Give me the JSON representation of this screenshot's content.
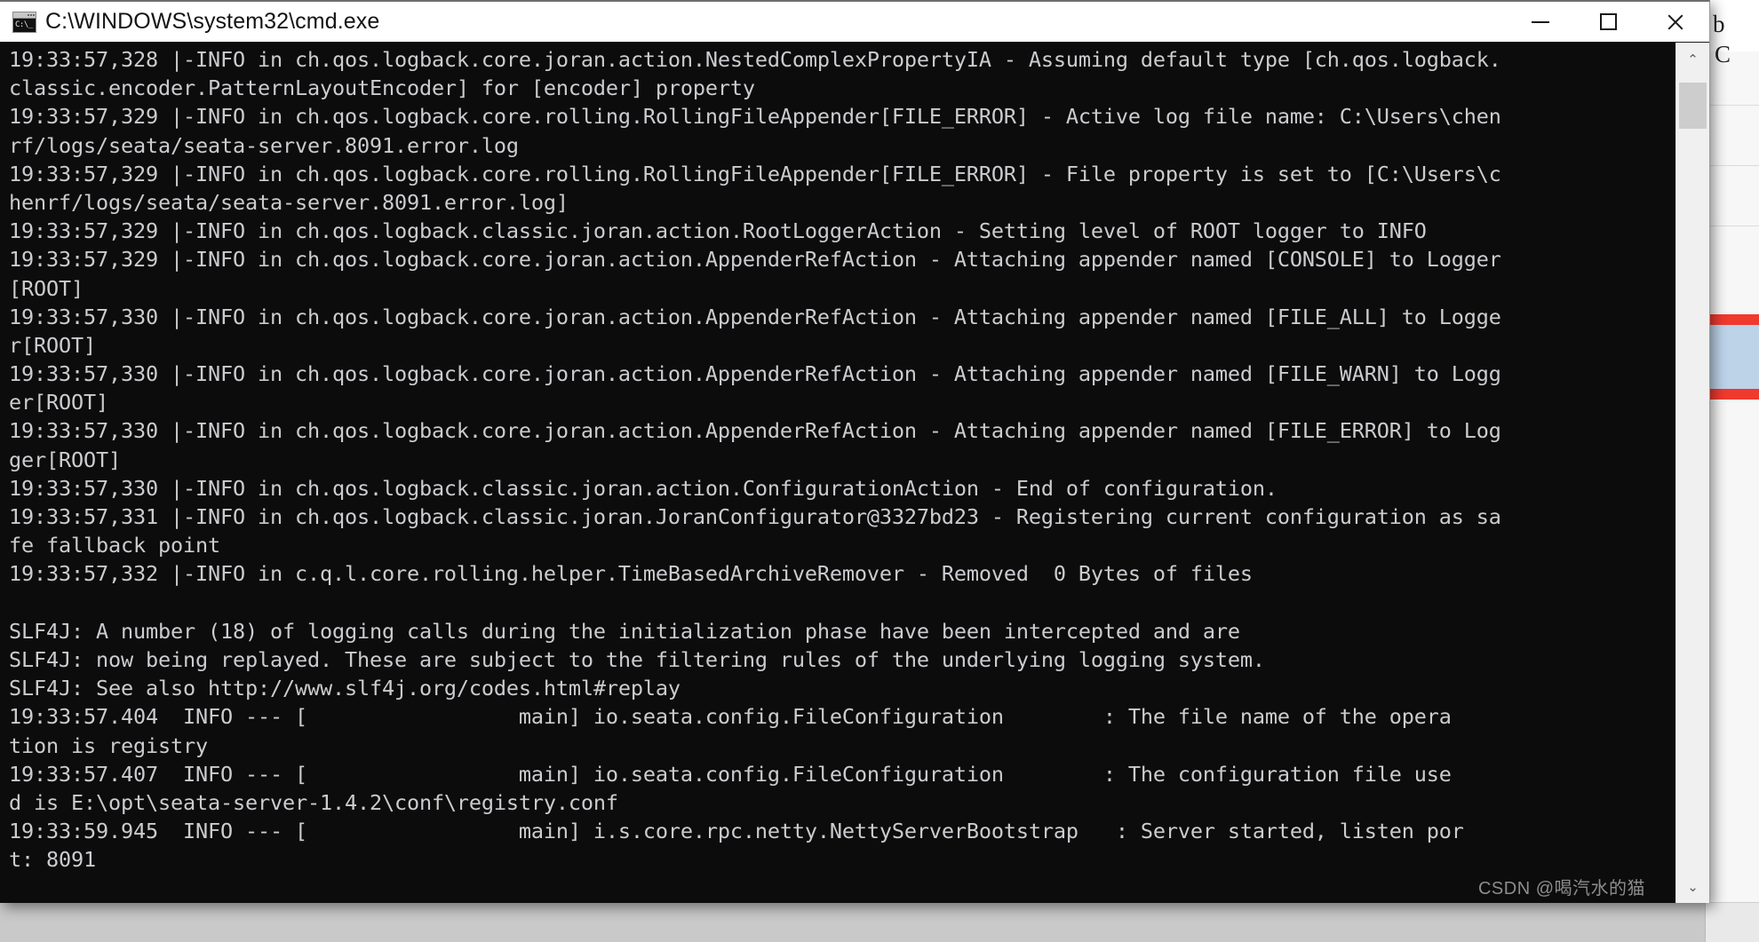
{
  "window": {
    "title": "C:\\WINDOWS\\system32\\cmd.exe",
    "icon_name": "cmd-icon",
    "icon_text": "C:\\_",
    "controls": {
      "minimize_label": "Minimize",
      "maximize_label": "Maximize",
      "close_label": "Close"
    },
    "colors": {
      "titlebar_bg": "#ffffff",
      "console_bg": "#0c0c0c",
      "console_fg": "#ccccd0",
      "scrollbar_bg": "#f0f0f0",
      "scrollbar_thumb": "#cdcdcd"
    }
  },
  "scrollbar": {
    "up_arrow": "⌃",
    "down_arrow": "⌄"
  },
  "watermark": "CSDN @喝汽水的猫",
  "console": {
    "lines": [
      "19:33:57,328 |-INFO in ch.qos.logback.core.joran.action.NestedComplexPropertyIA - Assuming default type [ch.qos.logback.",
      "classic.encoder.PatternLayoutEncoder] for [encoder] property",
      "19:33:57,329 |-INFO in ch.qos.logback.core.rolling.RollingFileAppender[FILE_ERROR] - Active log file name: C:\\Users\\chen",
      "rf/logs/seata/seata-server.8091.error.log",
      "19:33:57,329 |-INFO in ch.qos.logback.core.rolling.RollingFileAppender[FILE_ERROR] - File property is set to [C:\\Users\\c",
      "henrf/logs/seata/seata-server.8091.error.log]",
      "19:33:57,329 |-INFO in ch.qos.logback.classic.joran.action.RootLoggerAction - Setting level of ROOT logger to INFO",
      "19:33:57,329 |-INFO in ch.qos.logback.core.joran.action.AppenderRefAction - Attaching appender named [CONSOLE] to Logger",
      "[ROOT]",
      "19:33:57,330 |-INFO in ch.qos.logback.core.joran.action.AppenderRefAction - Attaching appender named [FILE_ALL] to Logge",
      "r[ROOT]",
      "19:33:57,330 |-INFO in ch.qos.logback.core.joran.action.AppenderRefAction - Attaching appender named [FILE_WARN] to Logg",
      "er[ROOT]",
      "19:33:57,330 |-INFO in ch.qos.logback.core.joran.action.AppenderRefAction - Attaching appender named [FILE_ERROR] to Log",
      "ger[ROOT]",
      "19:33:57,330 |-INFO in ch.qos.logback.classic.joran.action.ConfigurationAction - End of configuration.",
      "19:33:57,331 |-INFO in ch.qos.logback.classic.joran.JoranConfigurator@3327bd23 - Registering current configuration as sa",
      "fe fallback point",
      "19:33:57,332 |-INFO in c.q.l.core.rolling.helper.TimeBasedArchiveRemover - Removed  0 Bytes of files",
      "",
      "SLF4J: A number (18) of logging calls during the initialization phase have been intercepted and are",
      "SLF4J: now being replayed. These are subject to the filtering rules of the underlying logging system.",
      "SLF4J: See also http://www.slf4j.org/codes.html#replay",
      "19:33:57.404  INFO --- [                 main] io.seata.config.FileConfiguration        : The file name of the opera",
      "tion is registry",
      "19:33:57.407  INFO --- [                 main] io.seata.config.FileConfiguration        : The configuration file use",
      "d is E:\\opt\\seata-server-1.4.2\\conf\\registry.conf",
      "19:33:59.945  INFO --- [                 main] i.s.core.rpc.netty.NettyServerBootstrap   : Server started, listen por",
      "t: 8091"
    ]
  },
  "background": {
    "app_name": "background-editor-window",
    "visible_glyphs": [
      "C",
      "b",
      "⸨"
    ]
  }
}
